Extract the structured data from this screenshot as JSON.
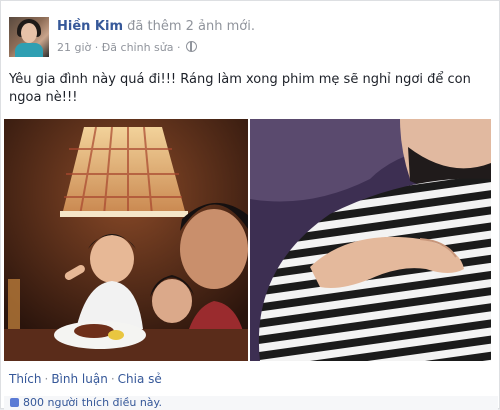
{
  "post": {
    "author": "Hiền Kim",
    "action": "đã thêm 2 ảnh mới.",
    "time": "21 giờ",
    "edited": "Đã chỉnh sửa",
    "status_text": "Yêu gia đình này quá đi!!! Ráng làm xong phim mẹ sẽ nghỉ ngơi để con ngoa nè!!!",
    "photos": [
      {
        "name": "family-dinner-photo"
      },
      {
        "name": "pregnant-belly-photo"
      }
    ]
  },
  "actions": {
    "like": "Thích",
    "comment": "Bình luận",
    "share": "Chia sẻ"
  },
  "likes_summary": "800 người thích điều này.",
  "colors": {
    "link": "#365899",
    "meta": "#90949c",
    "background": "#e9ebee"
  }
}
